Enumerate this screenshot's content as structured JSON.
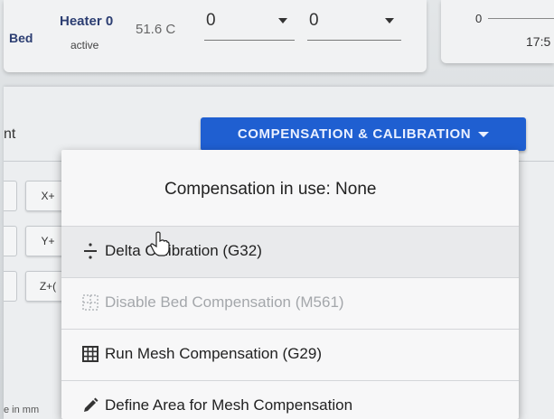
{
  "heater_panel": {
    "bed_label": "Bed",
    "heater_name": "Heater 0",
    "heater_state": "active",
    "current_temp": "51.6 C",
    "active_value": "0",
    "standby_value": "0"
  },
  "chart_panel": {
    "y_tick": "0",
    "x_tick": "17:5"
  },
  "main_card": {
    "title": "nt",
    "compensation_button_label": "COMPENSATION & CALIBRATION",
    "jog_buttons": [
      "X+",
      "Y+",
      "Z+("
    ],
    "units_note": "e in mm"
  },
  "dropdown": {
    "header": "Compensation in use: None",
    "items": [
      {
        "label": "Delta Calibration (G32)",
        "icon": "delta-calibration-icon",
        "disabled": false
      },
      {
        "label": "Disable Bed Compensation (M561)",
        "icon": "grid-off-icon",
        "disabled": true
      },
      {
        "label": "Run Mesh Compensation (G29)",
        "icon": "grid-icon",
        "disabled": false
      },
      {
        "label": "Define Area for Mesh Compensation",
        "icon": "pencil-icon",
        "disabled": false
      }
    ]
  },
  "colors": {
    "accent": "#1f5fd1",
    "label_blue": "#2c3e72",
    "disabled_text": "#a4a7ab"
  }
}
